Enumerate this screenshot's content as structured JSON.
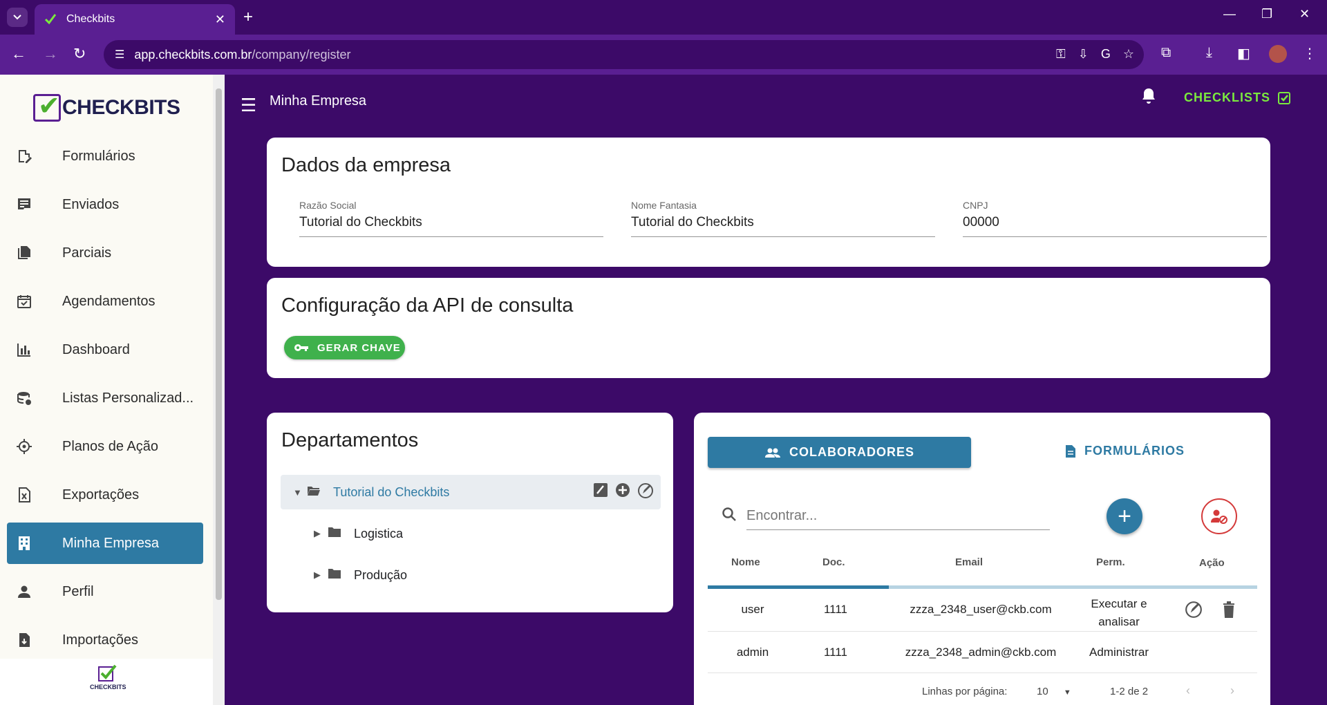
{
  "browser": {
    "tab_title": "Checkbits",
    "url_host": "app.checkbits.com.br",
    "url_path": "/company/register"
  },
  "sidebar": {
    "logo_text": "CHECKBITS",
    "items": [
      {
        "label": "Formulários",
        "icon": "form-edit-icon"
      },
      {
        "label": "Enviados",
        "icon": "sent-list-icon"
      },
      {
        "label": "Parciais",
        "icon": "partial-docs-icon"
      },
      {
        "label": "Agendamentos",
        "icon": "calendar-check-icon"
      },
      {
        "label": "Dashboard",
        "icon": "bar-chart-icon"
      },
      {
        "label": "Listas Personalizad...",
        "icon": "database-icon"
      },
      {
        "label": "Planos de Ação",
        "icon": "crosshair-icon"
      },
      {
        "label": "Exportações",
        "icon": "excel-export-icon"
      },
      {
        "label": "Minha Empresa",
        "icon": "building-icon"
      },
      {
        "label": "Perfil",
        "icon": "person-icon"
      },
      {
        "label": "Importações",
        "icon": "file-import-icon"
      }
    ],
    "footer_logo_text": "CHECKBITS"
  },
  "header": {
    "title": "Minha Empresa",
    "checklists_label": "CHECKLISTS"
  },
  "company": {
    "title": "Dados da empresa",
    "fields": [
      {
        "label": "Razão Social",
        "value": "Tutorial do Checkbits"
      },
      {
        "label": "Nome Fantasia",
        "value": "Tutorial do Checkbits"
      },
      {
        "label": "CNPJ",
        "value": "00000"
      }
    ]
  },
  "api": {
    "title": "Configuração da API de consulta",
    "generate_key_label": "GERAR CHAVE"
  },
  "departments": {
    "title": "Departamentos",
    "root": "Tutorial do Checkbits",
    "children": [
      "Logistica",
      "Produção"
    ]
  },
  "team": {
    "tab_collaborators": "COLABORADORES",
    "tab_forms": "FORMULÁRIOS",
    "search_placeholder": "Encontrar...",
    "columns": [
      "Nome",
      "Doc.",
      "Email",
      "Perm.",
      "Ação"
    ],
    "loading_progress": 0.33,
    "rows": [
      {
        "name": "user",
        "doc": "1111",
        "email": "zzza_2348_user@ckb.com",
        "perm": "Executar e analisar"
      },
      {
        "name": "admin",
        "doc": "1111",
        "email": "zzza_2348_admin@ckb.com",
        "perm": "Administrar"
      }
    ],
    "pagination": {
      "rows_per_page_label": "Linhas por página:",
      "rows_per_page": "10",
      "range": "1-2 de 2"
    }
  },
  "colors": {
    "brand_purple": "#3c0a68",
    "accent_blue": "#2e7aa3",
    "accent_green": "#3fb14c",
    "danger_red": "#d43a3a"
  }
}
